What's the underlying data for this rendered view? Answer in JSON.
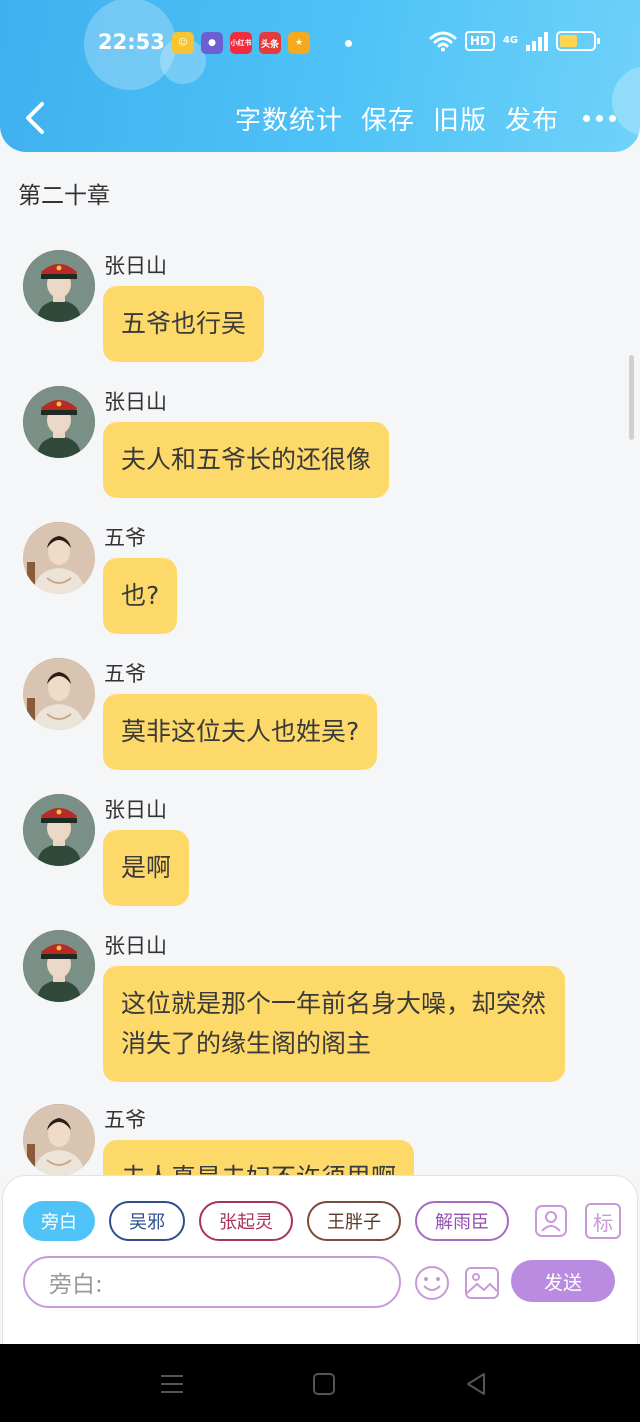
{
  "status_bar": {
    "time": "22:53",
    "apps": [
      {
        "icon": "smile-app-icon",
        "text": "☺",
        "color": "#f7c531"
      },
      {
        "icon": "chat-app-icon",
        "text": "●",
        "color": "#6b5fd1"
      },
      {
        "icon": "xiaohongshu-icon",
        "text": "小红书",
        "color": "#ef2d3c"
      },
      {
        "icon": "toutiao-icon",
        "text": "头条",
        "color": "#e33b3b"
      },
      {
        "icon": "game-app-icon",
        "text": "★",
        "color": "#f4a91e"
      }
    ],
    "hd": "HD",
    "network": "4G"
  },
  "nav": {
    "actions": [
      "字数统计",
      "保存",
      "旧版",
      "发布"
    ]
  },
  "chapter_title": "第二十章",
  "messages": [
    {
      "speaker": "张日山",
      "text": "五爷也行吴",
      "avatar": "zhang"
    },
    {
      "speaker": "张日山",
      "text": "夫人和五爷长的还很像",
      "avatar": "zhang"
    },
    {
      "speaker": "五爷",
      "text": "也?",
      "avatar": "wuye"
    },
    {
      "speaker": "五爷",
      "text": "莫非这位夫人也姓吴?",
      "avatar": "wuye"
    },
    {
      "speaker": "张日山",
      "text": "是啊",
      "avatar": "zhang"
    },
    {
      "speaker": "张日山",
      "text": "这位就是那个一年前名身大噪，却突然消失了的缘生阁的阁主",
      "avatar": "zhang"
    },
    {
      "speaker": "五爷",
      "text": "夫人真是夫妇不许须里啊",
      "avatar": "wuye"
    }
  ],
  "roles": [
    "旁白",
    "吴邪",
    "张起灵",
    "王胖子",
    "解雨臣"
  ],
  "tools": {
    "contact_icon": "contact-card-icon",
    "mark_label": "标"
  },
  "input": {
    "placeholder": "旁白:"
  },
  "send_label": "发送",
  "colors": {
    "header": "#4fc3f7",
    "bubble": "#fdd96a",
    "send": "#b98ce0"
  }
}
